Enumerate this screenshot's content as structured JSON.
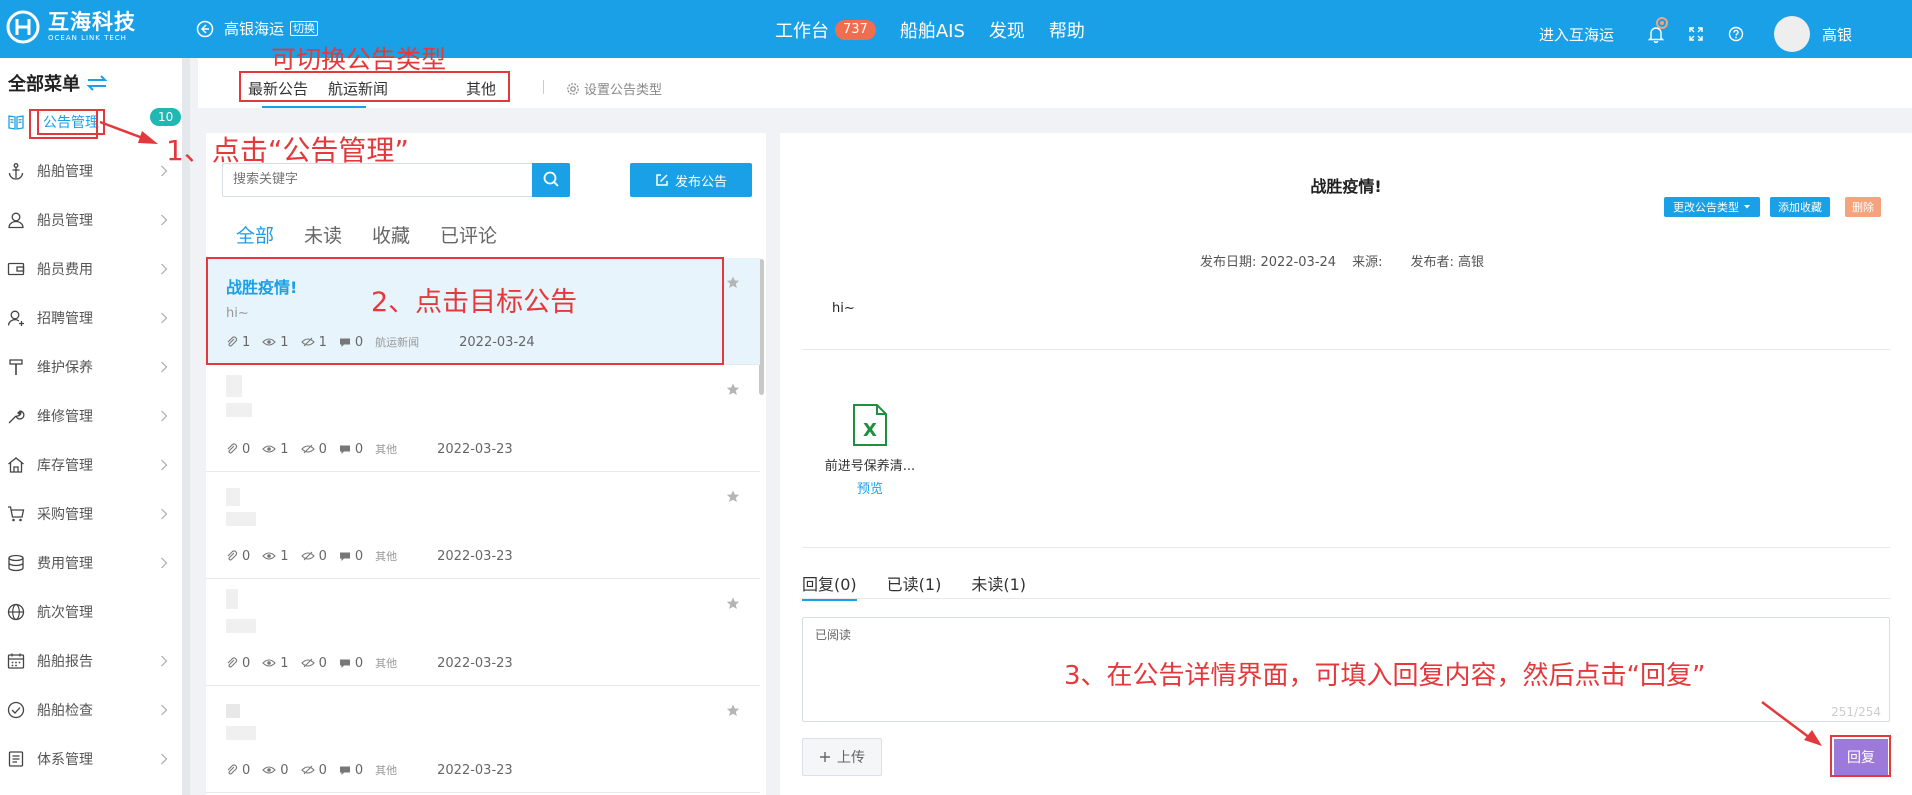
{
  "topbar": {
    "logo_cn": "互海科技",
    "logo_en": "OCEAN LINK TECH",
    "company": "高银海运",
    "switch_label": "切换",
    "nav": [
      {
        "label": "工作台",
        "badge": "737"
      },
      {
        "label": "船舶AIS"
      },
      {
        "label": "发现"
      },
      {
        "label": "帮助"
      }
    ],
    "enter_label": "进入互海运",
    "user_name": "高银"
  },
  "sidebar": {
    "title": "全部菜单",
    "badge": "10",
    "items": [
      {
        "label": "公告管理",
        "icon": "book-icon"
      },
      {
        "label": "船舶管理",
        "icon": "anchor-icon"
      },
      {
        "label": "船员管理",
        "icon": "user-icon"
      },
      {
        "label": "船员费用",
        "icon": "wallet-icon"
      },
      {
        "label": "招聘管理",
        "icon": "recruit-icon"
      },
      {
        "label": "维护保养",
        "icon": "hammer-icon"
      },
      {
        "label": "维修管理",
        "icon": "wrench-icon"
      },
      {
        "label": "库存管理",
        "icon": "house-icon"
      },
      {
        "label": "采购管理",
        "icon": "cart-icon"
      },
      {
        "label": "费用管理",
        "icon": "coins-icon"
      },
      {
        "label": "航次管理",
        "icon": "globe-icon"
      },
      {
        "label": "船舶报告",
        "icon": "calendar-icon"
      },
      {
        "label": "船舶检查",
        "icon": "check-circle-icon"
      },
      {
        "label": "体系管理",
        "icon": "doc-icon"
      }
    ]
  },
  "type_tabs": [
    "最新公告",
    "航运新闻",
    "其他"
  ],
  "settings_label": "设置公告类型",
  "list": {
    "search_placeholder": "搜索关键字",
    "publish_label": "发布公告",
    "filters": [
      "全部",
      "未读",
      "收藏",
      "已评论"
    ],
    "items": [
      {
        "title": "战胜疫情!",
        "excerpt": "hi~",
        "attach": "1",
        "views": "1",
        "read": "1",
        "comments": "0",
        "type": "航运新闻",
        "date": "2022-03-24"
      },
      {
        "title": "",
        "excerpt": "",
        "attach": "0",
        "views": "1",
        "read": "0",
        "comments": "0",
        "type": "其他",
        "date": "2022-03-23"
      },
      {
        "title": "",
        "excerpt": "",
        "attach": "0",
        "views": "1",
        "read": "0",
        "comments": "0",
        "type": "其他",
        "date": "2022-03-23"
      },
      {
        "title": "",
        "excerpt": "",
        "attach": "0",
        "views": "1",
        "read": "0",
        "comments": "0",
        "type": "其他",
        "date": "2022-03-23"
      },
      {
        "title": "",
        "excerpt": "",
        "attach": "0",
        "views": "0",
        "read": "0",
        "comments": "0",
        "type": "其他",
        "date": "2022-03-23"
      }
    ]
  },
  "detail": {
    "title": "战胜疫情!",
    "change_type_label": "更改公告类型",
    "favorite_label": "添加收藏",
    "delete_label": "删除",
    "publish_date": "发布日期: 2022-03-24",
    "source": "来源:",
    "publisher": "发布者: 高银",
    "body": "hi~",
    "attachment_name": "前进号保养清...",
    "preview_label": "预览",
    "reply_tabs": [
      "回复(0)",
      "已读(1)",
      "未读(1)"
    ],
    "reply_text": "已阅读",
    "char_count": "251/254",
    "upload_label": "上传",
    "reply_button": "回复"
  },
  "annotations": {
    "type_hint": "可切换公告类型",
    "step1": "1、点击“公告管理”",
    "step2": "2、点击目标公告",
    "step3": "3、在公告详情界面，可填入回复内容，然后点击“回复”"
  },
  "colors": {
    "primary": "#1aa0e6",
    "badge": "#f06d4f",
    "annotation": "#e4393c",
    "reply_button": "#9d79d9",
    "delete": "#f4a37c",
    "excel_green": "#1e8f3e"
  }
}
